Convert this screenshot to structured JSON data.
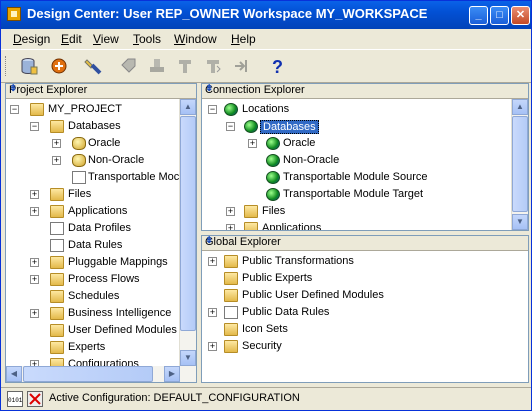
{
  "window": {
    "title": "Design Center: User REP_OWNER   Workspace MY_WORKSPACE",
    "buttons": {
      "minimize": "_",
      "maximize": "□",
      "close": "✕"
    }
  },
  "menubar": {
    "items": [
      {
        "label": "Design",
        "underline": "D"
      },
      {
        "label": "Edit",
        "underline": "E"
      },
      {
        "label": "View",
        "underline": "V"
      },
      {
        "label": "Tools",
        "underline": "T"
      },
      {
        "label": "Window",
        "underline": "W"
      },
      {
        "label": "Help",
        "underline": "H"
      }
    ]
  },
  "toolbar": {
    "icons": [
      "database-cylinder-icon",
      "deploy-icon",
      "flashlight-icon",
      "tag-icon",
      "stamp-icon",
      "validate-icon",
      "generate-icon",
      "import-icon",
      "help-icon"
    ]
  },
  "project_explorer": {
    "title": "Project Explorer",
    "items": [
      {
        "label": "MY_PROJECT",
        "icon": "project-icon"
      },
      {
        "label": "Databases",
        "icon": "folder-icon"
      },
      {
        "label": "Oracle",
        "icon": "database-icon"
      },
      {
        "label": "Non-Oracle",
        "icon": "database-icon"
      },
      {
        "label": "Transportable Moc",
        "icon": "module-icon"
      },
      {
        "label": "Files",
        "icon": "folder-icon"
      },
      {
        "label": "Applications",
        "icon": "folder-icon"
      },
      {
        "label": "Data Profiles",
        "icon": "document-icon"
      },
      {
        "label": "Data Rules",
        "icon": "document-icon"
      },
      {
        "label": "Pluggable Mappings",
        "icon": "folder-icon"
      },
      {
        "label": "Process Flows",
        "icon": "folder-icon"
      },
      {
        "label": "Schedules",
        "icon": "folder-icon"
      },
      {
        "label": "Business Intelligence",
        "icon": "folder-icon"
      },
      {
        "label": "User Defined Modules",
        "icon": "folder-icon"
      },
      {
        "label": "Experts",
        "icon": "folder-icon"
      },
      {
        "label": "Configurations",
        "icon": "folder-icon"
      }
    ]
  },
  "connection_explorer": {
    "title": "Connection Explorer",
    "items": [
      {
        "label": "Locations",
        "icon": "globe-icon"
      },
      {
        "label": "Databases",
        "icon": "globe-icon"
      },
      {
        "label": "Oracle",
        "icon": "globe-icon"
      },
      {
        "label": "Non-Oracle",
        "icon": "globe-icon"
      },
      {
        "label": "Transportable Module Source",
        "icon": "globe-icon"
      },
      {
        "label": "Transportable Module Target",
        "icon": "globe-icon"
      },
      {
        "label": "Files",
        "icon": "folder-icon"
      },
      {
        "label": "Applications",
        "icon": "folder-icon"
      }
    ]
  },
  "global_explorer": {
    "title": "Global Explorer",
    "items": [
      {
        "label": "Public Transformations",
        "icon": "transformations-icon"
      },
      {
        "label": "Public Experts",
        "icon": "folder-icon"
      },
      {
        "label": "Public User Defined Modules",
        "icon": "folder-icon"
      },
      {
        "label": "Public Data Rules",
        "icon": "document-icon"
      },
      {
        "label": "Icon Sets",
        "icon": "folder-icon"
      },
      {
        "label": "Security",
        "icon": "lock-folder-icon"
      }
    ]
  },
  "statusbar": {
    "text": "Active Configuration: DEFAULT_CONFIGURATION"
  },
  "pin_glyph": "⇟",
  "expander": {
    "plus": "+",
    "minus": "−"
  }
}
